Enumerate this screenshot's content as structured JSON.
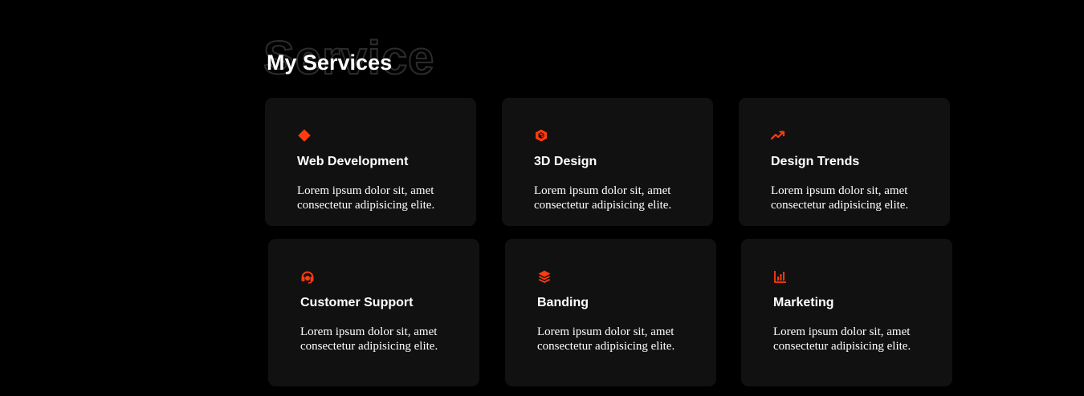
{
  "services": {
    "background_word": "Service",
    "heading": "My Services",
    "accent_color": "#ff3b0f",
    "cards": [
      {
        "icon": "diamond-icon",
        "title": "Web Development",
        "description": "Lorem ipsum dolor sit, amet consectetur adipisicing elite."
      },
      {
        "icon": "cube-icon",
        "title": "3D Design",
        "description": "Lorem ipsum dolor sit, amet consectetur adipisicing elite."
      },
      {
        "icon": "trend-up-icon",
        "title": "Design Trends",
        "description": "Lorem ipsum dolor sit, amet consectetur adipisicing elite."
      },
      {
        "icon": "headset-icon",
        "title": "Customer Support",
        "description": "Lorem ipsum dolor sit, amet consectetur adipisicing elite."
      },
      {
        "icon": "layers-icon",
        "title": "Banding",
        "description": "Lorem ipsum dolor sit, amet consectetur adipisicing elite."
      },
      {
        "icon": "bar-chart-icon",
        "title": "Marketing",
        "description": "Lorem ipsum dolor sit, amet consectetur adipisicing elite."
      }
    ]
  }
}
